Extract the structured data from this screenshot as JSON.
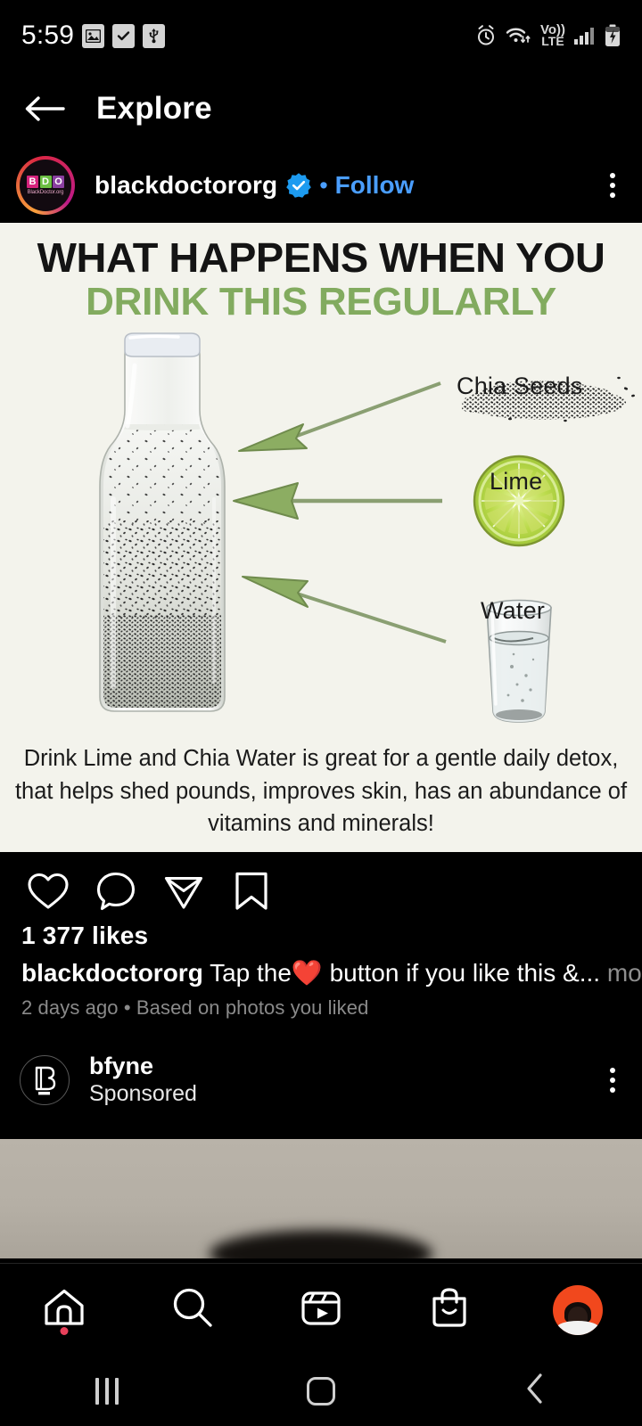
{
  "status_bar": {
    "time": "5:59",
    "left_icons": [
      "image-icon",
      "checkbox-icon",
      "usb-icon"
    ],
    "network_label": "Vo))",
    "network_type": "LTE",
    "right_icons": [
      "alarm-icon",
      "wifi-icon",
      "signal-icon",
      "battery-charging-icon"
    ]
  },
  "header": {
    "title": "Explore",
    "back_icon": "back-arrow-icon"
  },
  "post": {
    "author": "blackdoctororg",
    "verified": true,
    "separator": "•",
    "follow_label": "Follow",
    "avatar": {
      "letters": [
        "B",
        "D",
        "O"
      ],
      "subtitle": "BlackDoctor.org"
    },
    "image": {
      "headline_line1": "WHAT HAPPENS WHEN YOU",
      "headline_line2": "DRINK THIS REGULARLY",
      "headline_color_1": "#141414",
      "headline_color_2": "#82ab5f",
      "background_color": "#f3f3ec",
      "arrow_color": "#7d9d5d",
      "labels": [
        {
          "name": "Chia Seeds"
        },
        {
          "name": "Lime"
        },
        {
          "name": "Water"
        }
      ],
      "caption_lines": [
        "Drink Lime and Chia Water is great for a gentle daily detox,",
        "that helps shed pounds, improves skin, has an abundance of",
        "vitamins and minerals!"
      ]
    },
    "actions": {
      "like": "heart-icon",
      "comment": "comment-icon",
      "share": "share-icon",
      "save": "bookmark-icon"
    },
    "likes": "1 377 likes",
    "caption_author": "blackdoctororg",
    "caption_text": " Tap the❤️ button if you like this &...",
    "caption_more": " more",
    "meta": "2 days ago • Based on photos you liked"
  },
  "sponsored": {
    "name": "bfyne",
    "label": "Sponsored",
    "avatar_letter": "B"
  },
  "bottom_nav": {
    "items": [
      {
        "icon": "home-icon",
        "badge": true
      },
      {
        "icon": "search-icon",
        "badge": false
      },
      {
        "icon": "reels-icon",
        "badge": false
      },
      {
        "icon": "shop-icon",
        "badge": false
      },
      {
        "icon": "profile-avatar",
        "badge": false
      }
    ],
    "badge_color": "#e8405a",
    "avatar_background": "#f1481d"
  },
  "android_nav": {
    "recents": "recents-icon",
    "home": "home-button-icon",
    "back": "back-button-icon"
  }
}
